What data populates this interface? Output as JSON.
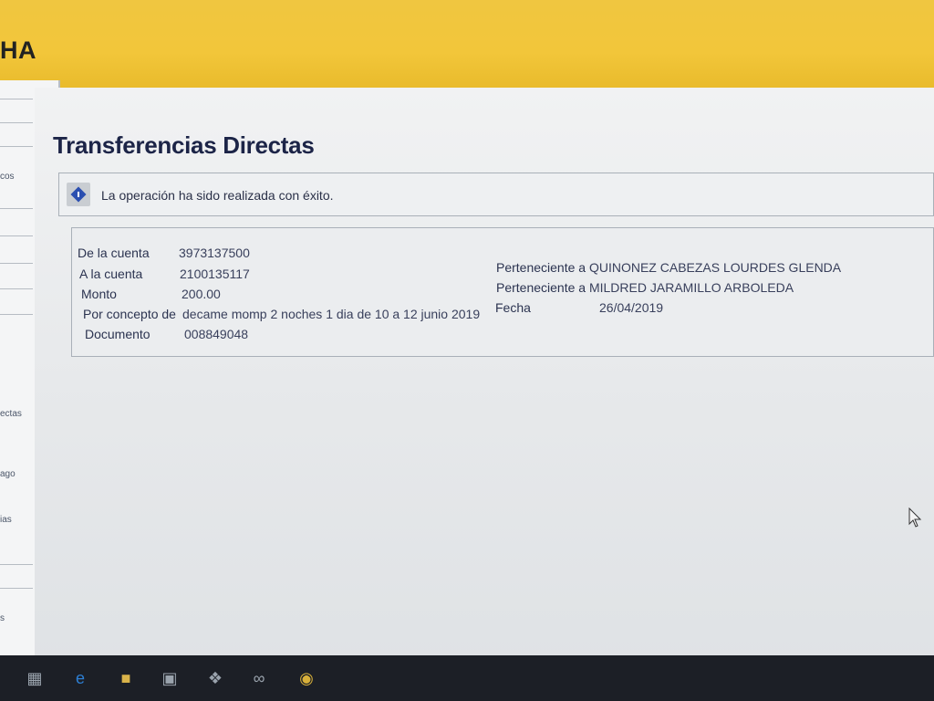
{
  "header": {
    "brand": "HA"
  },
  "sidebar": {
    "items": [
      {
        "label": "cos"
      },
      {
        "label": "ectas"
      },
      {
        "label": "ago"
      },
      {
        "label": "ias"
      },
      {
        "label": "s"
      }
    ]
  },
  "page": {
    "title": "Transferencias Directas",
    "message": "La operación ha sido realizada con éxito."
  },
  "details": {
    "from_account_label": "De la cuenta",
    "from_account_value": "3973137500",
    "to_account_label": "A la cuenta",
    "to_account_value": "2100135117",
    "amount_label": "Monto",
    "amount_value": "200.00",
    "concept_label": "Por concepto de",
    "concept_value": "decame momp 2 noches 1 dia de 10 a 12 junio 2019",
    "document_label": "Documento",
    "document_value": "008849048",
    "owner_from_label": "Perteneciente a",
    "owner_from_value": "QUINONEZ CABEZAS LOURDES GLENDA",
    "owner_to_label": "Perteneciente a",
    "owner_to_value": "MILDRED JARAMILLO ARBOLEDA",
    "date_label": "Fecha",
    "date_value": "26/04/2019"
  },
  "taskbar": {
    "icons": [
      "task-view-icon",
      "edge-icon",
      "file-explorer-icon",
      "store-icon",
      "dropbox-icon",
      "infinity-icon",
      "chrome-icon"
    ]
  },
  "colors": {
    "header_yellow": "#f2c63a",
    "title_navy": "#1c2447",
    "info_blue": "#2b4fb0"
  }
}
